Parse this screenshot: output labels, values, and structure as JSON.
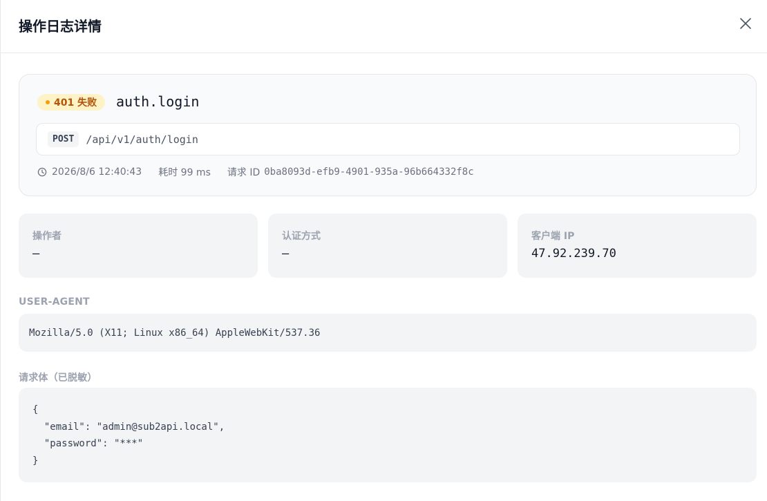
{
  "modal": {
    "title": "操作日志详情"
  },
  "summary": {
    "status_badge": "401 失败",
    "action": "auth.login",
    "method": "POST",
    "path": "/api/v1/auth/login",
    "timestamp": "2026/8/6 12:40:43",
    "duration_label": "耗时 99 ms",
    "request_id_label": "请求 ID",
    "request_id": "0ba8093d-efb9-4901-935a-96b664332f8c"
  },
  "info_cards": [
    {
      "label": "操作者",
      "value": "—"
    },
    {
      "label": "认证方式",
      "value": "—"
    },
    {
      "label": "客户端 IP",
      "value": "47.92.239.70"
    }
  ],
  "user_agent": {
    "label": "USER-AGENT",
    "value": "Mozilla/5.0 (X11; Linux x86_64) AppleWebKit/537.36"
  },
  "request_body": {
    "label": "请求体（已脱敏）",
    "content": "{\n  \"email\": \"admin@sub2api.local\",\n  \"password\": \"***\"\n}"
  },
  "colors": {
    "status_bg": "#fef3c7",
    "status_text": "#b45309",
    "status_dot": "#f59e0b"
  },
  "icons": {
    "close": "close-icon",
    "clock": "clock-icon"
  }
}
